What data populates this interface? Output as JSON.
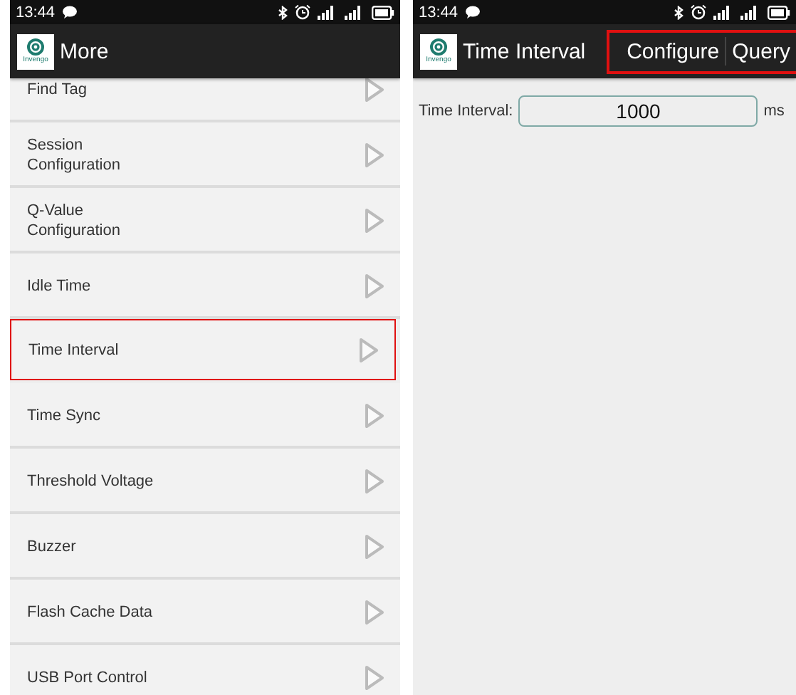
{
  "screens": [
    {
      "status_bar": {
        "time": "13:44"
      },
      "app_bar": {
        "logo_text": "Invengo",
        "title": "More"
      },
      "menu_items": [
        {
          "label": "Find Tag",
          "highlighted": false
        },
        {
          "label": "Session Configuration",
          "highlighted": false
        },
        {
          "label": "Q-Value Configuration",
          "highlighted": false
        },
        {
          "label": "Idle Time",
          "highlighted": false
        },
        {
          "label": "Time Interval",
          "highlighted": true
        },
        {
          "label": "Time Sync",
          "highlighted": false
        },
        {
          "label": "Threshold Voltage",
          "highlighted": false
        },
        {
          "label": "Buzzer",
          "highlighted": false
        },
        {
          "label": "Flash Cache Data",
          "highlighted": false
        },
        {
          "label": "USB Port Control",
          "highlighted": false
        }
      ]
    },
    {
      "status_bar": {
        "time": "13:44"
      },
      "app_bar": {
        "logo_text": "Invengo",
        "title": "Time Interval",
        "actions": [
          "Configure",
          "Query"
        ],
        "actions_highlighted": true
      },
      "form": {
        "label": "Time Interval:",
        "value": "1000",
        "unit": "ms"
      }
    }
  ]
}
